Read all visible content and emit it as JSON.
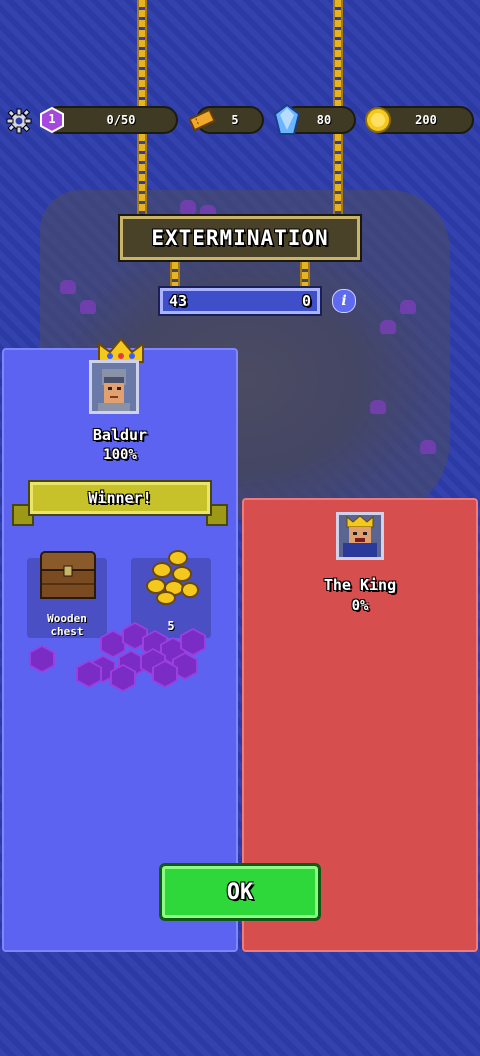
{
  "resources": {
    "level_value": "1",
    "xp": "0/50",
    "tickets": "5",
    "gems": "80",
    "gold": "200"
  },
  "battle": {
    "mode_title": "EXTERMINATION",
    "score_left": "43",
    "score_right": "0",
    "info_symbol": "i"
  },
  "winner_panel": {
    "player_name": "Baldur",
    "player_percent": "100%",
    "result_label": "Winner!",
    "rewards": [
      {
        "label": "Wooden\nchest",
        "icon": "wooden-chest-icon"
      },
      {
        "label": "5",
        "icon": "gold-coins-icon"
      }
    ]
  },
  "loser_panel": {
    "player_name": "The King",
    "player_percent": "0%"
  },
  "ok_label": "OK",
  "colors": {
    "winner_panel": "#5b63f0",
    "loser_panel": "#d74e4e",
    "ok_button": "#2fd83a",
    "gem_hex": "#9a3fe0"
  }
}
